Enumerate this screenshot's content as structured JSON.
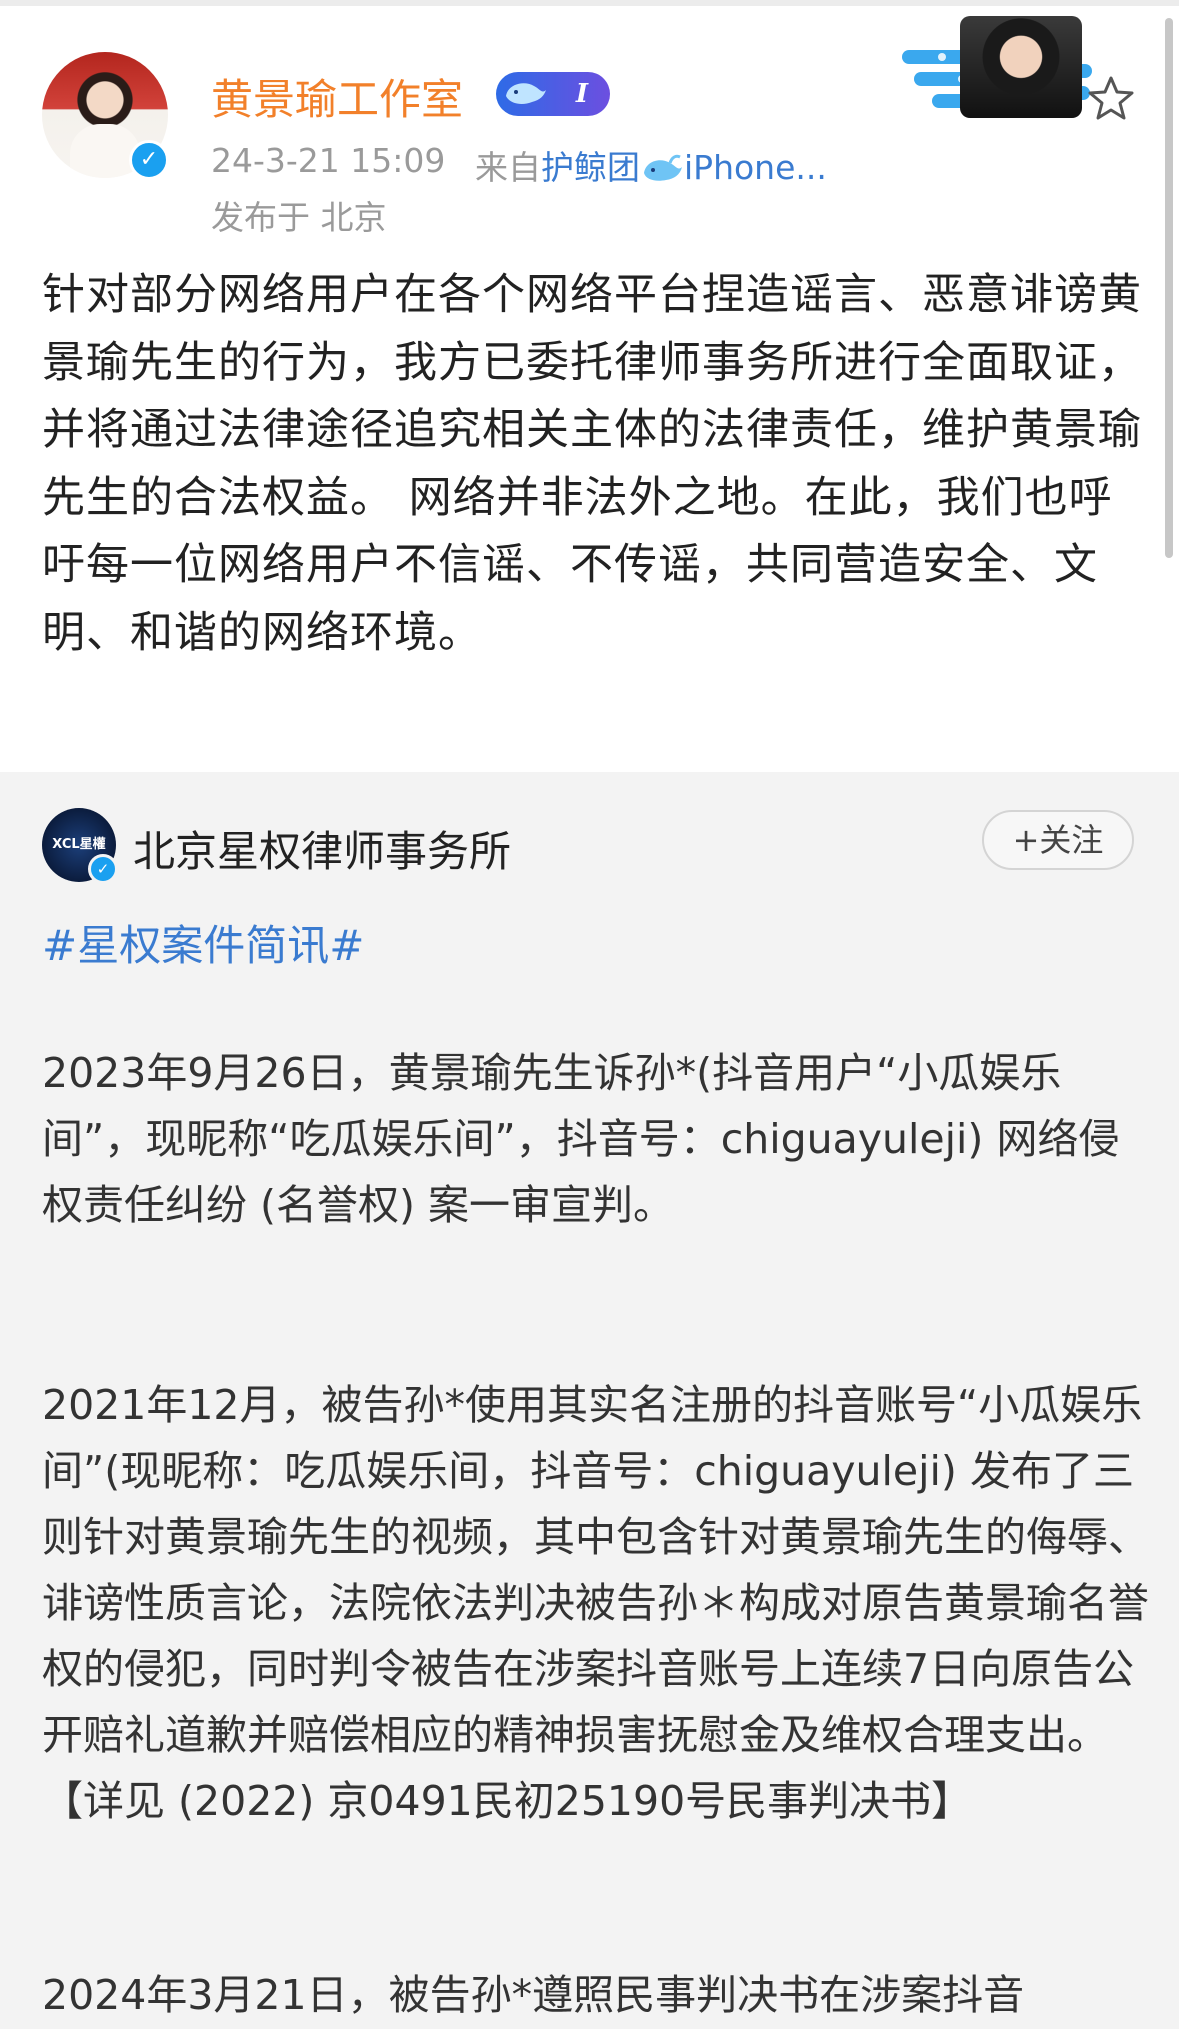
{
  "post": {
    "author": "黄景瑜工作室",
    "vip_level": "I",
    "time": "24-3-21 15:09",
    "source_prefix": "来自",
    "source_name": "护鲸团",
    "device": "iPhone...",
    "location": "发布于 北京",
    "body": "针对部分网络用户在各个网络平台捏造谣言、恶意诽谤黄景瑜先生的行为，我方已委托律师事务所进行全面取证，并将通过法律途径追究相关主体的法律责任，维护黄景瑜先生的合法权益。 网络并非法外之地。在此，我们也呼吁每一位网络用户不信谣、不传谣，共同营造安全、文明、和谐的网络环境。"
  },
  "repost": {
    "author": "北京星权律师事务所",
    "follow_label": "+关注",
    "avatar_text": "XCL星權",
    "hashtag": "#星权案件简讯#",
    "paragraphs": [
      "2023年9月26日，黄景瑜先生诉孙*(抖音用户“小瓜娱乐间”，现昵称“吃瓜娱乐间”，抖音号：chiguayuleji) 网络侵权责任纠纷 (名誉权) 案一审宣判。",
      "2021年12月，被告孙*使用其实名注册的抖音账号“小瓜娱乐间”(现昵称：吃瓜娱乐间，抖音号：chiguayuleji) 发布了三则针对黄景瑜先生的视频，其中包含针对黄景瑜先生的侮辱、诽谤性质言论，法院依法判决被告孙＊构成对原告黄景瑜名誉权的侵犯，同时判令被告在涉案抖音账号上连续7日向原告公开赔礼道歉并赔偿相应的精神损害抚慰金及维权合理支出。【详见 (2022) 京0491民初25190号民事判决书】",
      "2024年3月21日，被告孙*遵照民事判决书在涉案抖音"
    ]
  },
  "icons": [
    "verified-badge-icon",
    "whale-icon",
    "star-icon",
    "plus-icon"
  ],
  "colors": {
    "author_orange": "#f2802a",
    "link_blue": "#3a7bd0",
    "meta_gray": "#9a9a9a",
    "verified_blue": "#1aa0f0",
    "repost_bg": "#f3f3f3"
  }
}
